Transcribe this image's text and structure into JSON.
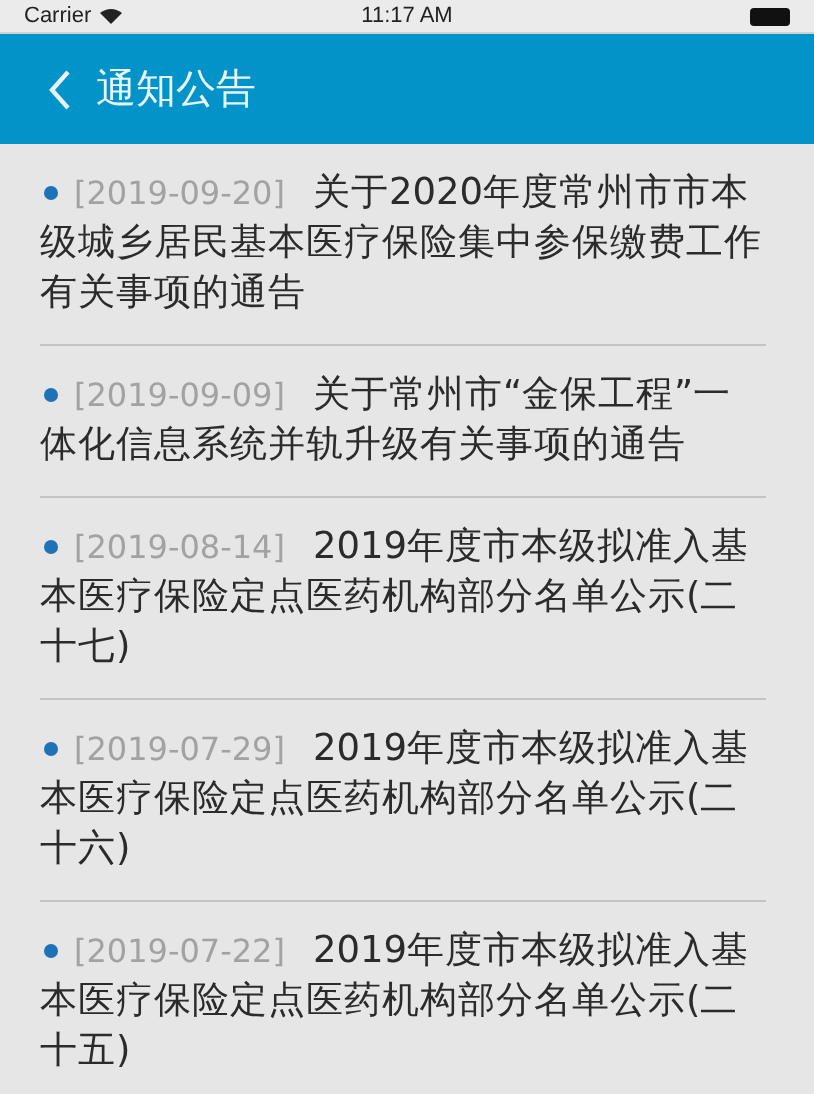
{
  "status_bar": {
    "carrier": "Carrier",
    "time": "11:17 AM"
  },
  "header": {
    "title": "通知公告"
  },
  "notices": [
    {
      "date": "[2019-09-20]",
      "title": "关于2020年度常州市市本级城乡居民基本医疗保险集中参保缴费工作有关事项的通告"
    },
    {
      "date": "[2019-09-09]",
      "title": "关于常州市“金保工程”一体化信息系统并轨升级有关事项的通告"
    },
    {
      "date": "[2019-08-14]",
      "title": "2019年度市本级拟准入基本医疗保险定点医药机构部分名单公示(二十七)"
    },
    {
      "date": "[2019-07-29]",
      "title": "2019年度市本级拟准入基本医疗保险定点医药机构部分名单公示(二十六)"
    },
    {
      "date": "[2019-07-22]",
      "title": "2019年度市本级拟准入基本医疗保险定点医药机构部分名单公示(二十五)"
    }
  ]
}
